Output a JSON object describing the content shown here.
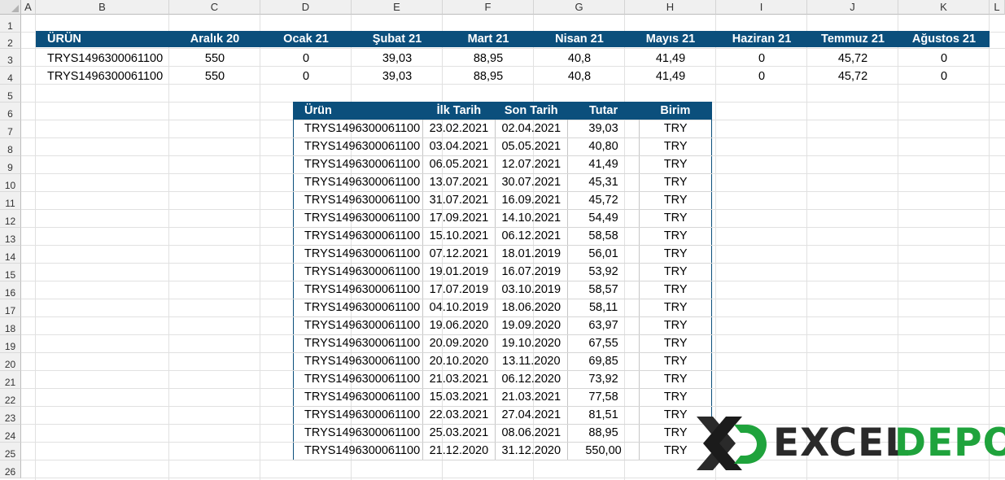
{
  "sheet": {
    "columns": [
      "A",
      "B",
      "C",
      "D",
      "E",
      "F",
      "G",
      "H",
      "I",
      "J",
      "K",
      "L"
    ],
    "rows": [
      "1",
      "2",
      "3",
      "4",
      "5",
      "6",
      "7",
      "8",
      "9",
      "10",
      "11",
      "12",
      "13",
      "14",
      "15",
      "16",
      "17",
      "18",
      "19",
      "20",
      "21",
      "22",
      "23",
      "24",
      "25",
      "26"
    ]
  },
  "top_table": {
    "headers": [
      "ÜRÜN",
      "Aralık 20",
      "Ocak 21",
      "Şubat 21",
      "Mart 21",
      "Nisan 21",
      "Mayıs 21",
      "Haziran 21",
      "Temmuz 21",
      "Ağustos 21"
    ],
    "rows": [
      [
        "TRYS1496300061100",
        "550",
        "0",
        "39,03",
        "88,95",
        "40,8",
        "41,49",
        "0",
        "45,72",
        "0"
      ],
      [
        "TRYS1496300061100",
        "550",
        "0",
        "39,03",
        "88,95",
        "40,8",
        "41,49",
        "0",
        "45,72",
        "0"
      ]
    ]
  },
  "bottom_table": {
    "headers": [
      "Ürün",
      "İlk Tarih",
      "Son Tarih",
      "Tutar",
      "Birim"
    ],
    "rows": [
      [
        "TRYS1496300061100",
        "23.02.2021",
        "02.04.2021",
        "39,03",
        "TRY"
      ],
      [
        "TRYS1496300061100",
        "03.04.2021",
        "05.05.2021",
        "40,80",
        "TRY"
      ],
      [
        "TRYS1496300061100",
        "06.05.2021",
        "12.07.2021",
        "41,49",
        "TRY"
      ],
      [
        "TRYS1496300061100",
        "13.07.2021",
        "30.07.2021",
        "45,31",
        "TRY"
      ],
      [
        "TRYS1496300061100",
        "31.07.2021",
        "16.09.2021",
        "45,72",
        "TRY"
      ],
      [
        "TRYS1496300061100",
        "17.09.2021",
        "14.10.2021",
        "54,49",
        "TRY"
      ],
      [
        "TRYS1496300061100",
        "15.10.2021",
        "06.12.2021",
        "58,58",
        "TRY"
      ],
      [
        "TRYS1496300061100",
        "07.12.2021",
        "18.01.2019",
        "56,01",
        "TRY"
      ],
      [
        "TRYS1496300061100",
        "19.01.2019",
        "16.07.2019",
        "53,92",
        "TRY"
      ],
      [
        "TRYS1496300061100",
        "17.07.2019",
        "03.10.2019",
        "58,57",
        "TRY"
      ],
      [
        "TRYS1496300061100",
        "04.10.2019",
        "18.06.2020",
        "58,11",
        "TRY"
      ],
      [
        "TRYS1496300061100",
        "19.06.2020",
        "19.09.2020",
        "63,97",
        "TRY"
      ],
      [
        "TRYS1496300061100",
        "20.09.2020",
        "19.10.2020",
        "67,55",
        "TRY"
      ],
      [
        "TRYS1496300061100",
        "20.10.2020",
        "13.11.2020",
        "69,85",
        "TRY"
      ],
      [
        "TRYS1496300061100",
        "21.03.2021",
        "06.12.2020",
        "73,92",
        "TRY"
      ],
      [
        "TRYS1496300061100",
        "15.03.2021",
        "21.03.2021",
        "77,58",
        "TRY"
      ],
      [
        "TRYS1496300061100",
        "22.03.2021",
        "27.04.2021",
        "81,51",
        "TRY"
      ],
      [
        "TRYS1496300061100",
        "25.03.2021",
        "08.06.2021",
        "88,95",
        "TRY"
      ],
      [
        "TRYS1496300061100",
        "21.12.2020",
        "31.12.2020",
        "550,00",
        "TRY"
      ]
    ]
  },
  "logo": {
    "word1": "EXCEL",
    "word2": "DEPO",
    "color_dark": "#2a2a2a",
    "color_green": "#1fa33c"
  },
  "colors": {
    "header_fill": "#0b4f7c",
    "header_text": "#ffffff",
    "grid": "#e1e1e1"
  }
}
